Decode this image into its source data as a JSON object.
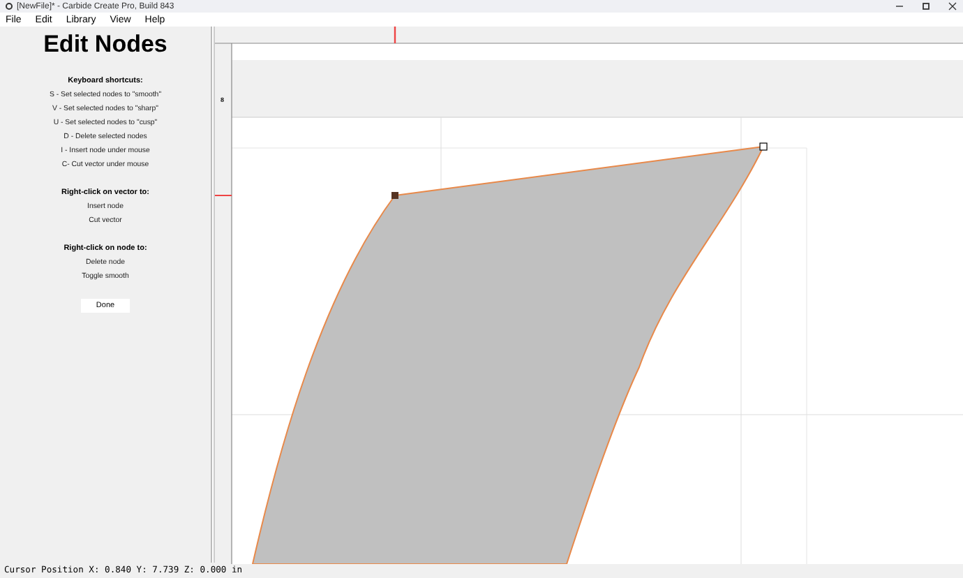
{
  "window": {
    "title": "[NewFile]* - Carbide Create Pro, Build 843"
  },
  "menu": [
    "File",
    "Edit",
    "Library",
    "View",
    "Help"
  ],
  "panel": {
    "title": "Edit Nodes",
    "sections": [
      {
        "heading": "Keyboard shortcuts:",
        "lines": [
          "S - Set selected nodes to \"smooth\"",
          "V - Set selected nodes to \"sharp\"",
          "U - Set selected nodes to \"cusp\"",
          "D - Delete selected nodes",
          "I - Insert node under mouse",
          "C- Cut vector under mouse"
        ]
      },
      {
        "heading": "Right-click on vector to:",
        "lines": [
          "Insert node",
          "Cut vector"
        ]
      },
      {
        "heading": "Right-click on node to:",
        "lines": [
          "Delete node",
          "Toggle smooth"
        ]
      }
    ],
    "button": "Done"
  },
  "ruler": {
    "left_label": "8"
  },
  "status_bar": "Cursor Position X: 0.840 Y: 7.739 Z: 0.000 in"
}
